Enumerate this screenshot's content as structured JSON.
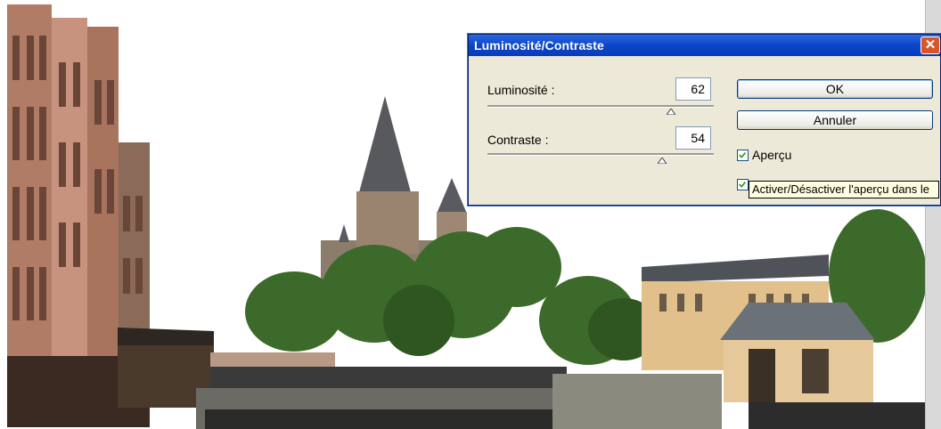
{
  "dialog": {
    "title": "Luminosité/Contraste",
    "close_glyph": "✕",
    "brightness": {
      "label": "Luminosité :",
      "value": "62",
      "level": 0.81
    },
    "contrast": {
      "label": "Contraste :",
      "value": "54",
      "level": 0.77
    },
    "ok_label": "OK",
    "cancel_label": "Annuler",
    "preview_label": "Aperçu",
    "preview_checked": true,
    "legacy_checked": true,
    "tooltip": "Activer/Désactiver l'aperçu dans le"
  },
  "colors": {
    "title_blue": "#0a46c9",
    "dialog_bg": "#ece9d8",
    "close_red": "#d9542b",
    "check_green": "#21a121"
  }
}
